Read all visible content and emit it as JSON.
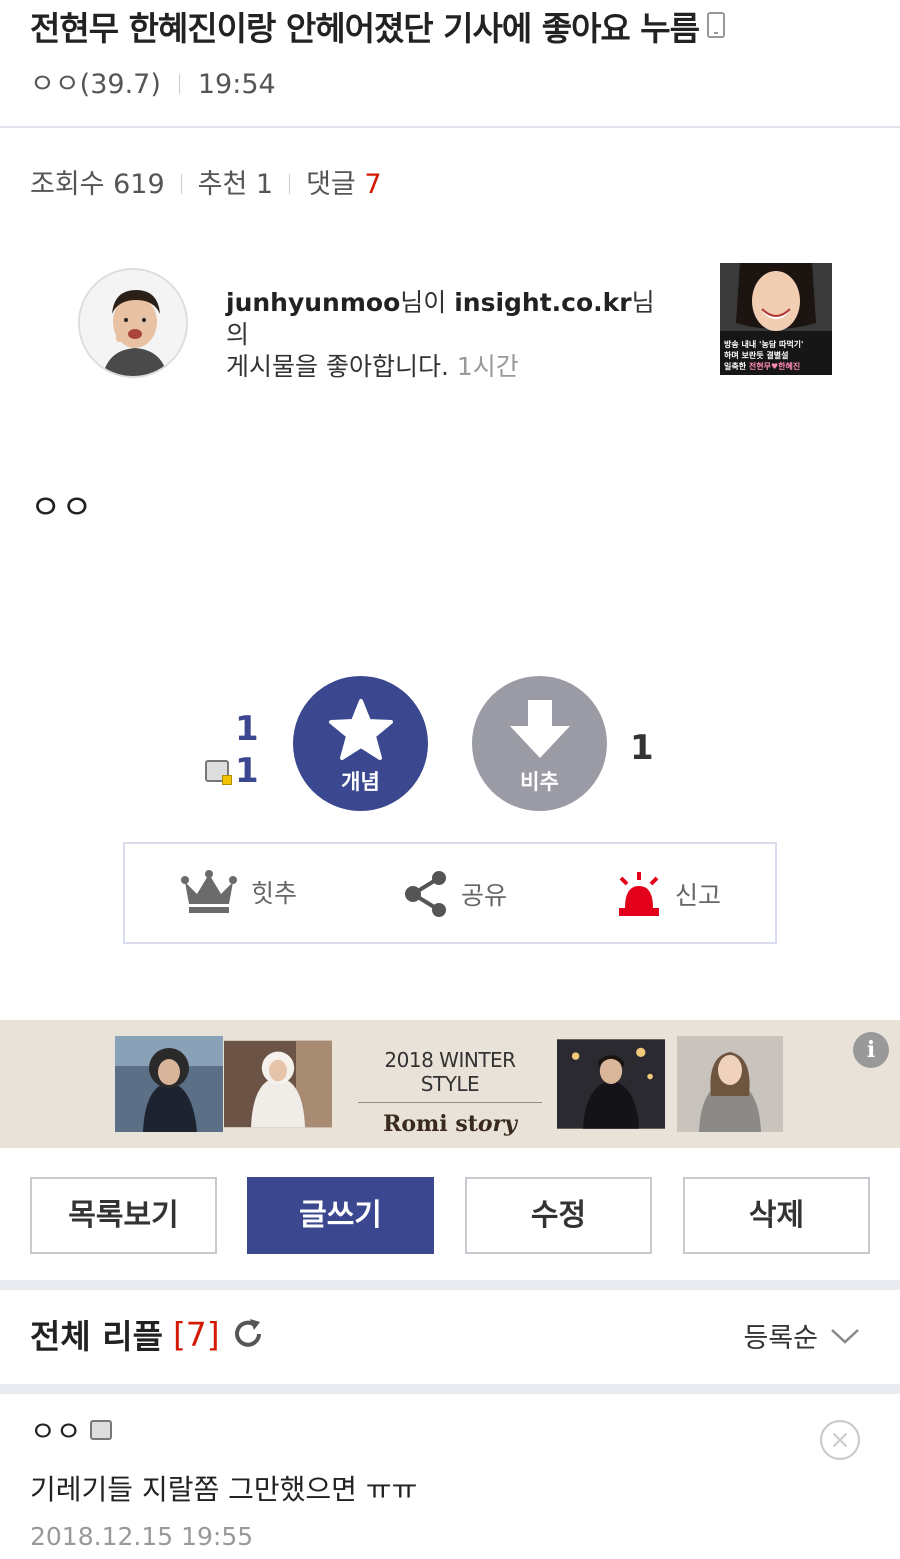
{
  "post": {
    "title": "전현무 한혜진이랑 안헤어졌단 기사에 좋아요 누름",
    "author": "ㅇㅇ(39.7)",
    "time": "19:54",
    "views_label": "조회수 619",
    "recommend_label": "추천 1",
    "comments_label": "댓글",
    "comments_count": "7",
    "body": "ㅇㅇ"
  },
  "embed": {
    "user": "junhyunmoo",
    "user_suffix": "님이 ",
    "target": "insight.co.kr",
    "target_suffix": "님의",
    "action": "게시물을 좋아합니다.",
    "time": "1시간",
    "thumb_line1": "방송 내내 '농담 따먹기'",
    "thumb_line2": "하며 보란듯 결별설",
    "thumb_line3_a": "일축한 ",
    "thumb_line3_b": "전현무♥한혜진"
  },
  "votes": {
    "up_count": "1",
    "up_fixed_count": "1",
    "up_label": "개념",
    "down_label": "비추",
    "down_count": "1"
  },
  "actions": {
    "hit_label": "힛추",
    "share_label": "공유",
    "report_label": "신고"
  },
  "ad": {
    "style_text": "2018 WINTER STYLE",
    "brand_main": "Romi st",
    "brand_script": "ory"
  },
  "buttons": {
    "list": "목록보기",
    "write": "글쓰기",
    "edit": "수정",
    "delete": "삭제"
  },
  "replies": {
    "title": "전체 리플",
    "count": "[7]",
    "sort": "등록순"
  },
  "comment": {
    "author": "ㅇㅇ",
    "text": "기레기들 지랄쫌 그만했으면 ㅠㅠ",
    "date": "2018.12.15 19:55"
  },
  "colors": {
    "accent": "#3b4890",
    "downvote": "#9b9ba6",
    "highlight_red": "#d31900",
    "ad_bg": "#e9e2d8"
  }
}
